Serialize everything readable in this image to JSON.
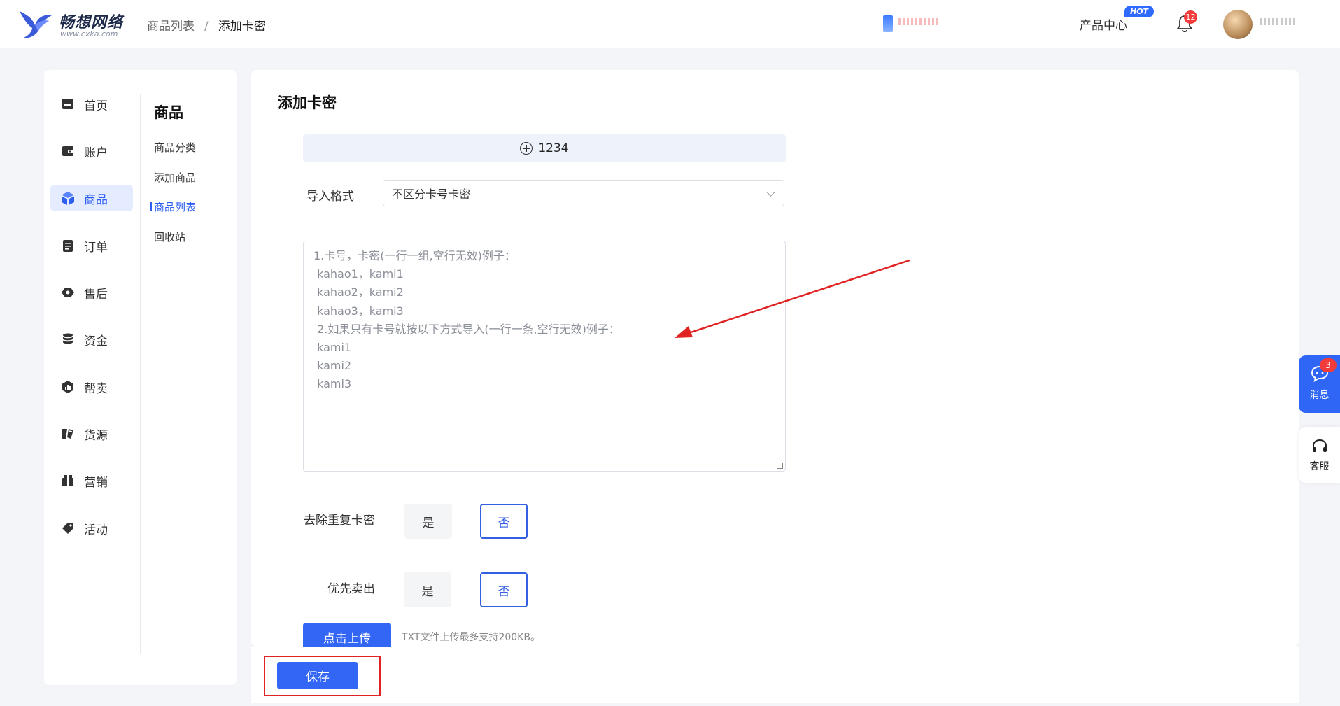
{
  "header": {
    "brand_name": "畅想网络",
    "brand_url": "www.cxka.com",
    "breadcrumb": [
      "商品列表",
      "添加卡密"
    ],
    "product_center": "产品中心",
    "hot_badge": "HOT",
    "notification_count": "12"
  },
  "sidebar": {
    "items": [
      {
        "label": "首页",
        "icon": "home-icon"
      },
      {
        "label": "账户",
        "icon": "wallet-icon"
      },
      {
        "label": "商品",
        "icon": "box-icon",
        "active": true
      },
      {
        "label": "订单",
        "icon": "order-icon"
      },
      {
        "label": "售后",
        "icon": "aftersale-icon"
      },
      {
        "label": "资金",
        "icon": "coins-icon"
      },
      {
        "label": "帮卖",
        "icon": "chart-icon"
      },
      {
        "label": "货源",
        "icon": "source-icon"
      },
      {
        "label": "营销",
        "icon": "marketing-icon"
      },
      {
        "label": "活动",
        "icon": "tag-icon"
      }
    ],
    "sub_title": "商品",
    "sub_items": [
      "商品分类",
      "添加商品",
      "商品列表",
      "回收站"
    ],
    "active_sub": "商品列表"
  },
  "main": {
    "title": "添加卡密",
    "add_bar_label": "1234",
    "import_format_label": "导入格式",
    "import_format_value": "不区分卡号卡密",
    "textarea_placeholder": [
      "1.卡号，卡密(一行一组,空行无效)例子：",
      " kahao1，kami1",
      " kahao2，kami2",
      " kahao3，kami3",
      " 2.如果只有卡号就按以下方式导入(一行一条,空行无效)例子：",
      " kami1",
      " kami2",
      " kami3"
    ],
    "dedupe_label": "去除重复卡密",
    "priority_label": "优先卖出",
    "yes": "是",
    "no": "否",
    "upload_button": "点击上传",
    "upload_hint": "TXT文件上传最多支持200KB。",
    "save_button": "保存"
  },
  "float": {
    "message_label": "消息",
    "message_count": "3",
    "service_label": "客服"
  },
  "colors": {
    "primary": "#3466f5",
    "annotation_red": "#e02222",
    "badge_red": "#f23c3c"
  }
}
